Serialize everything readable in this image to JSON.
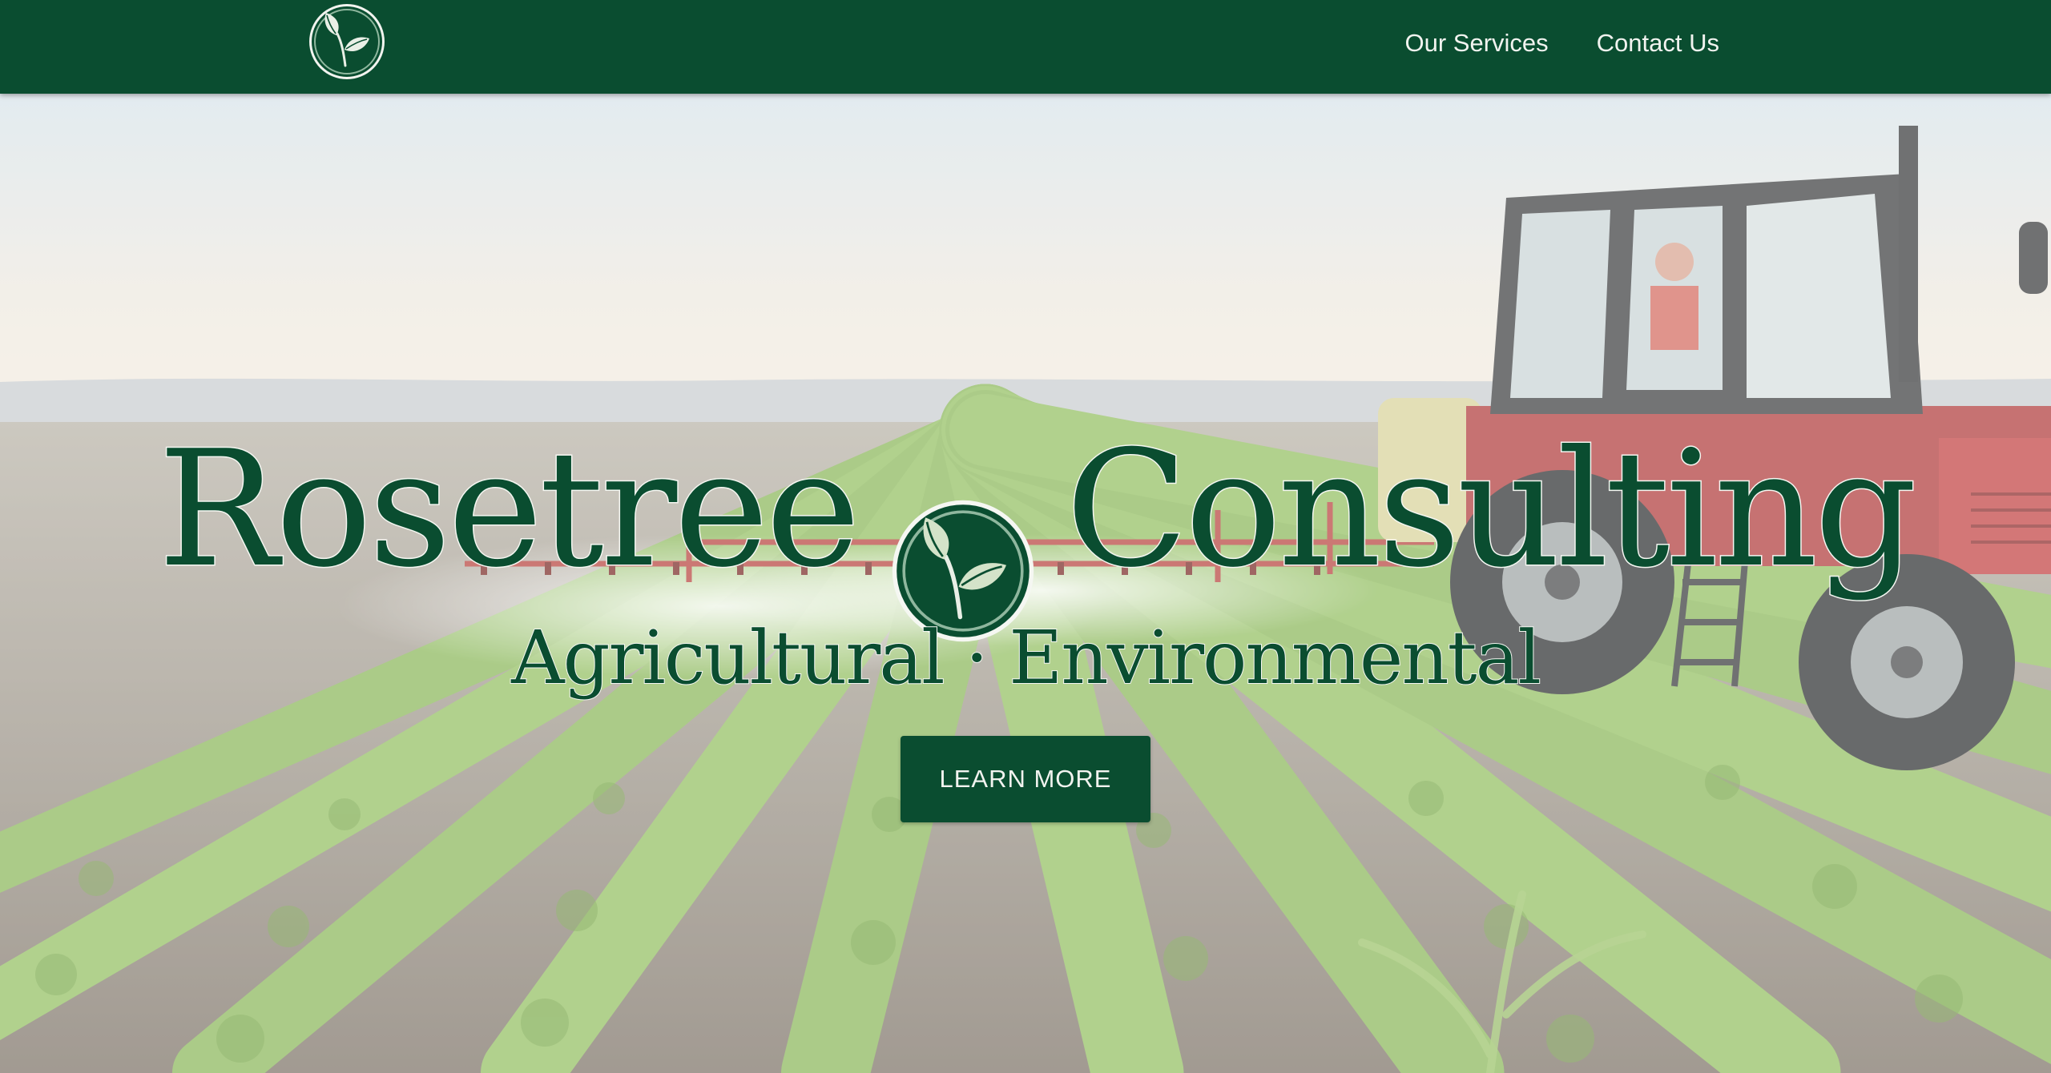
{
  "brand": {
    "name_left": "Rosetree",
    "name_right": "Consulting",
    "logo_icon": "leaf-sprout-icon",
    "primary_color": "#0a4d30"
  },
  "nav": {
    "links": [
      {
        "label": "Our Services"
      },
      {
        "label": "Contact Us"
      }
    ]
  },
  "hero": {
    "tagline": "Agricultural · Environmental",
    "cta_label": "LEARN MORE",
    "background": "tractor-spraying-crop-field-photo"
  }
}
